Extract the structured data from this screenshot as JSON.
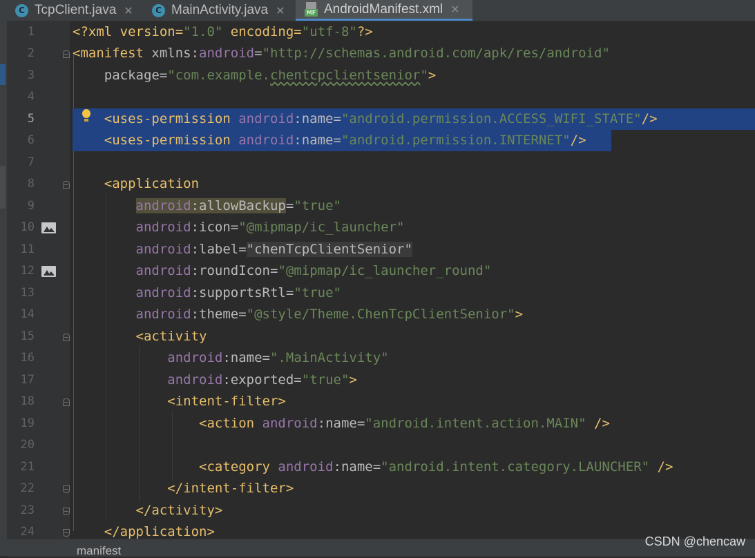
{
  "tabs": [
    {
      "label": "TcpClient.java",
      "icon": "java-class-icon",
      "icon_letter": "C",
      "close": "✕"
    },
    {
      "label": "MainActivity.java",
      "icon": "java-class-icon",
      "icon_letter": "C",
      "close": "✕"
    },
    {
      "label": "AndroidManifest.xml",
      "icon": "manifest-file-icon",
      "icon_letter": "MF",
      "close": "✕",
      "active": true
    }
  ],
  "gutter": {
    "line_numbers": [
      "1",
      "2",
      "3",
      "4",
      "5",
      "6",
      "7",
      "8",
      "9",
      "10",
      "11",
      "12",
      "13",
      "14",
      "15",
      "16",
      "17",
      "18",
      "19",
      "20",
      "21",
      "22",
      "23",
      "24"
    ],
    "current_line": "5"
  },
  "code": {
    "l1": {
      "a": "<?xml version=",
      "b": "\"1.0\"",
      "c": " encoding=",
      "d": "\"utf-8\"",
      "e": "?>"
    },
    "l2": {
      "a": "<manifest",
      "b": " xmlns:",
      "c": "android",
      "d": "=",
      "e": "\"http://schemas.android.com/apk/res/android\""
    },
    "l3": {
      "a": "    package=",
      "b": "\"com.example.",
      "c": "chentcpclientsenior",
      "d": "\"",
      "e": ">"
    },
    "l5": {
      "a": "    <uses-permission",
      "b": " android",
      "c": ":name=",
      "d": "\"android.permission.ACCESS_WIFI_STATE\"",
      "e": "/>"
    },
    "l6": {
      "a": "    <uses-permission",
      "b": " android",
      "c": ":name=",
      "d": "\"android.permission.INTERNET\"",
      "e": "/>"
    },
    "l8": {
      "a": "    <application"
    },
    "l9": {
      "a": "        ",
      "b": "android",
      "c": ":",
      "d": "allowBackup",
      "e": "=",
      "f": "\"true\""
    },
    "l10": {
      "a": "        ",
      "b": "android",
      "c": ":icon=",
      "d": "\"@mipmap/ic_launcher\""
    },
    "l11": {
      "a": "        ",
      "b": "android",
      "c": ":label=",
      "d": "\"chenTcpClientSenior\""
    },
    "l12": {
      "a": "        ",
      "b": "android",
      "c": ":roundIcon=",
      "d": "\"@mipmap/ic_launcher_round\""
    },
    "l13": {
      "a": "        ",
      "b": "android",
      "c": ":supportsRtl=",
      "d": "\"true\""
    },
    "l14": {
      "a": "        ",
      "b": "android",
      "c": ":theme=",
      "d": "\"@style/Theme.ChenTcpClientSenior\"",
      "e": ">"
    },
    "l15": {
      "a": "        <activity"
    },
    "l16": {
      "a": "            ",
      "b": "android",
      "c": ":name=",
      "d": "\".MainActivity\""
    },
    "l17": {
      "a": "            ",
      "b": "android",
      "c": ":exported=",
      "d": "\"true\"",
      "e": ">"
    },
    "l18": {
      "a": "            <intent-filter>"
    },
    "l19": {
      "a": "                <action",
      "b": " android",
      "c": ":name=",
      "d": "\"android.intent.action.MAIN\"",
      "e": " />"
    },
    "l21": {
      "a": "                <category",
      "b": " android",
      "c": ":name=",
      "d": "\"android.intent.category.LAUNCHER\"",
      "e": " />"
    },
    "l22": {
      "a": "            </intent-filter>"
    },
    "l23": {
      "a": "        </activity>"
    },
    "l24": {
      "a": "    </application>"
    }
  },
  "breadcrumb": "manifest",
  "watermark": "CSDN @chencaw",
  "colors": {
    "editor_bg": "#2b2b2b",
    "selection": "#214283",
    "tag": "#e8bf6a",
    "namespace": "#9876aa",
    "string": "#6a8759",
    "accent_tab": "#4a88c7"
  }
}
